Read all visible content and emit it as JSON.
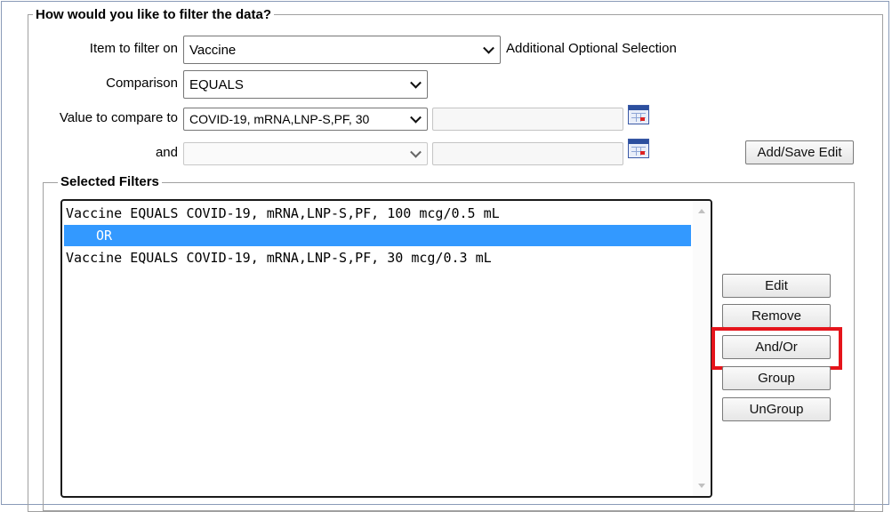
{
  "filter_section": {
    "legend": "How would you like to filter the data?",
    "item_label": "Item to filter on",
    "item_value": "Vaccine",
    "additional_selection": "Additional Optional Selection",
    "comparison_label": "Comparison",
    "comparison_value": "EQUALS",
    "value_label": "Value to compare to",
    "value_value": "COVID-19, mRNA,LNP-S,PF, 30",
    "and_label": "and",
    "and_value": "",
    "add_save_button": "Add/Save Edit"
  },
  "selected_filters": {
    "legend": "Selected Filters",
    "rows": [
      "Vaccine EQUALS COVID-19, mRNA,LNP-S,PF, 100 mcg/0.5 mL",
      "    OR",
      "Vaccine EQUALS COVID-19, mRNA,LNP-S,PF, 30 mcg/0.3 mL"
    ],
    "selected_row": 1,
    "buttons": {
      "edit": "Edit",
      "remove": "Remove",
      "and_or": "And/Or",
      "group": "Group",
      "ungroup": "UnGroup"
    },
    "highlighted_button": "And/Or",
    "highlight_color": "#e5141b",
    "selection_color": "#3399ff"
  }
}
